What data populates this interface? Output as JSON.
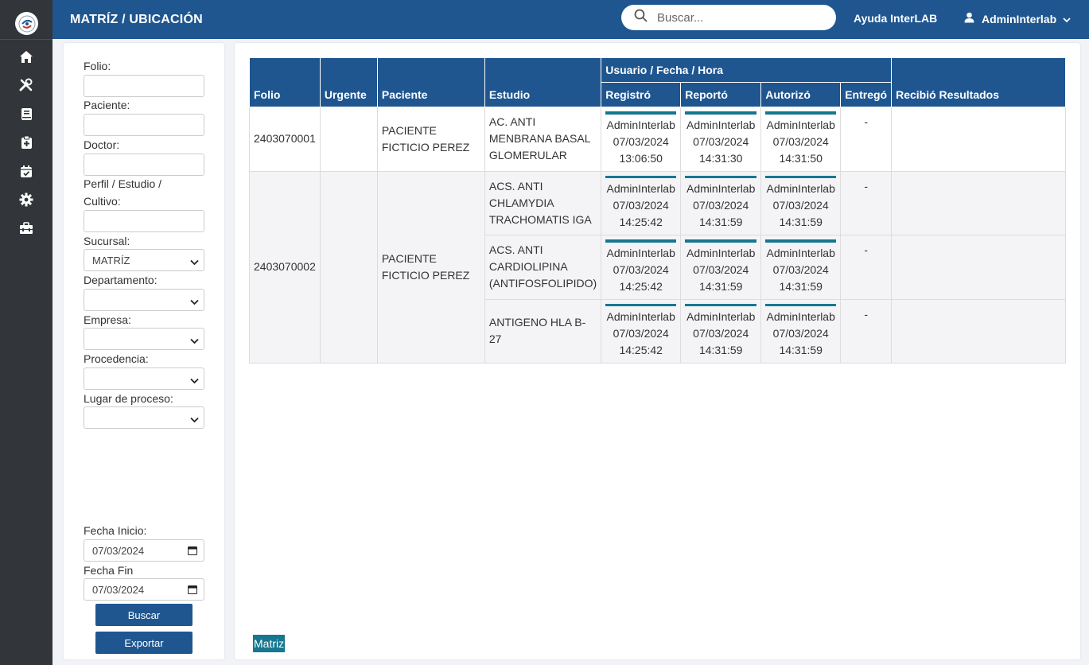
{
  "header": {
    "title": "MATRÍZ / UBICACIÓN",
    "search_placeholder": "Buscar...",
    "help_label": "Ayuda InterLAB",
    "user_name": "AdminInterlab"
  },
  "sidebar": {
    "icons": [
      "home-icon",
      "tools-icon",
      "book-icon",
      "clipboard-medical-icon",
      "calendar-check-icon",
      "gear-icon",
      "toolbox-icon"
    ]
  },
  "filters": {
    "folio_label": "Folio:",
    "paciente_label": "Paciente:",
    "doctor_label": "Doctor:",
    "perfil_label": "Perfil / Estudio / Cultivo:",
    "sucursal_label": "Sucursal:",
    "sucursal_value": "MATRÍZ",
    "departamento_label": "Departamento:",
    "empresa_label": "Empresa:",
    "procedencia_label": "Procedencia:",
    "lugar_label": "Lugar de proceso:",
    "fecha_inicio_label": "Fecha Inicio:",
    "fecha_inicio_value": "07/03/2024",
    "fecha_fin_label": "Fecha Fin",
    "fecha_fin_value": "07/03/2024",
    "buscar_button": "Buscar",
    "exportar_button": "Exportar"
  },
  "table": {
    "headers": {
      "folio": "Folio",
      "urgente": "Urgente",
      "paciente": "Paciente",
      "estudio": "Estudio",
      "group": "Usuario / Fecha / Hora",
      "registro": "Registró",
      "reporto": "Reportó",
      "autorizo": "Autorizó",
      "entrego": "Entregó",
      "recibio": "Recibió Resultados"
    },
    "groups": [
      {
        "folio": "2403070001",
        "paciente": "PACIENTE FICTICIO PEREZ",
        "studies": [
          {
            "estudio": "AC. ANTI MENBRANA BASAL GLOMERULAR",
            "registro": {
              "user": "AdminInterlab",
              "date": "07/03/2024",
              "time": "13:06:50"
            },
            "reporto": {
              "user": "AdminInterlab",
              "date": "07/03/2024",
              "time": "14:31:30"
            },
            "autorizo": {
              "user": "AdminInterlab",
              "date": "07/03/2024",
              "time": "14:31:50"
            },
            "entrego": "-"
          }
        ]
      },
      {
        "folio": "2403070002",
        "paciente": "PACIENTE FICTICIO PEREZ",
        "studies": [
          {
            "estudio": "ACS. ANTI CHLAMYDIA TRACHOMATIS IGA",
            "registro": {
              "user": "AdminInterlab",
              "date": "07/03/2024",
              "time": "14:25:42"
            },
            "reporto": {
              "user": "AdminInterlab",
              "date": "07/03/2024",
              "time": "14:31:59"
            },
            "autorizo": {
              "user": "AdminInterlab",
              "date": "07/03/2024",
              "time": "14:31:59"
            },
            "entrego": "-"
          },
          {
            "estudio": "ACS. ANTI CARDIOLIPINA (ANTIFOSFOLIPIDO)",
            "registro": {
              "user": "AdminInterlab",
              "date": "07/03/2024",
              "time": "14:25:42"
            },
            "reporto": {
              "user": "AdminInterlab",
              "date": "07/03/2024",
              "time": "14:31:59"
            },
            "autorizo": {
              "user": "AdminInterlab",
              "date": "07/03/2024",
              "time": "14:31:59"
            },
            "entrego": "-"
          },
          {
            "estudio": "ANTIGENO HLA B-27",
            "registro": {
              "user": "AdminInterlab",
              "date": "07/03/2024",
              "time": "14:25:42"
            },
            "reporto": {
              "user": "AdminInterlab",
              "date": "07/03/2024",
              "time": "14:31:59"
            },
            "autorizo": {
              "user": "AdminInterlab",
              "date": "07/03/2024",
              "time": "14:31:59"
            },
            "entrego": "-"
          }
        ]
      }
    ]
  },
  "footer": {
    "matriz_label": "Matriz"
  },
  "colors": {
    "header_blue": "#1f5690",
    "rail_dark": "#323539",
    "accent_teal": "#157790"
  }
}
